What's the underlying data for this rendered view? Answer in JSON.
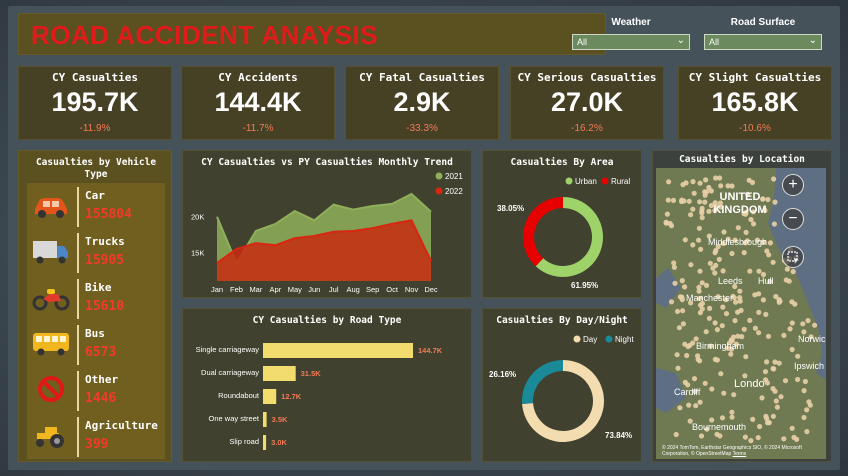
{
  "title": "ROAD ACCIDENT ANAYSIS",
  "filters": {
    "weather": {
      "label": "Weather",
      "value": "All"
    },
    "road_surface": {
      "label": "Road Surface",
      "value": "All"
    }
  },
  "kpis": [
    {
      "title": "CY Casualties",
      "value": "195.7K",
      "delta": "-11.9%"
    },
    {
      "title": "CY Accidents",
      "value": "144.4K",
      "delta": "-11.7%"
    },
    {
      "title": "CY Fatal Casualties",
      "value": "2.9K",
      "delta": "-33.3%"
    },
    {
      "title": "CY Serious Casualties",
      "value": "27.0K",
      "delta": "-16.2%"
    },
    {
      "title": "CY Slight Casualties",
      "value": "165.8K",
      "delta": "-10.6%"
    }
  ],
  "vehicles": {
    "title": "Casualties by Vehicle Type",
    "items": [
      {
        "name": "Car",
        "value": "155804",
        "icon": "car-icon"
      },
      {
        "name": "Trucks",
        "value": "15905",
        "icon": "truck-icon"
      },
      {
        "name": "Bike",
        "value": "15610",
        "icon": "motorbike-icon"
      },
      {
        "name": "Bus",
        "value": "6573",
        "icon": "bus-icon"
      },
      {
        "name": "Other",
        "value": "1446",
        "icon": "prohibited-icon"
      },
      {
        "name": "Agriculture",
        "value": "399",
        "icon": "tractor-icon"
      }
    ]
  },
  "colors": {
    "series_2021": "#8fb05a",
    "series_2022": "#d8260f",
    "bar": "#f2dc6e",
    "urban": "#9ed36a",
    "rural": "#e60000",
    "day": "#f3dcb0",
    "night": "#1a8a98",
    "delta": "#f27a54",
    "vehicle_value": "#f23b2a"
  },
  "chart_data": [
    {
      "type": "area",
      "title": "CY Casualties vs PY Casualties Monthly Trend",
      "categories": [
        "Jan",
        "Feb",
        "Mar",
        "Apr",
        "May",
        "Jun",
        "Jul",
        "Aug",
        "Sep",
        "Oct",
        "Nov",
        "Dec"
      ],
      "series": [
        {
          "name": "2021",
          "values": [
            20000,
            13500,
            18000,
            19000,
            20800,
            19500,
            21700,
            21000,
            21500,
            21800,
            23200,
            20700
          ]
        },
        {
          "name": "2022",
          "values": [
            13500,
            15500,
            16300,
            16000,
            17000,
            17300,
            17900,
            18000,
            18400,
            19000,
            19500,
            13800
          ]
        }
      ],
      "y_ticks": [
        "15K",
        "20K"
      ],
      "legend": "top-right"
    },
    {
      "type": "bar",
      "title": "CY Casualties by Road Type",
      "categories": [
        "Single carriageway",
        "Dual carriageway",
        "Roundabout",
        "One way street",
        "Slip road"
      ],
      "values": [
        144700,
        31500,
        12700,
        3500,
        3000
      ],
      "data_labels": [
        "144.7K",
        "31.5K",
        "12.7K",
        "3.5K",
        "3.0K"
      ]
    },
    {
      "type": "pie",
      "title": "Casualties By Area",
      "categories": [
        "Urban",
        "Rural"
      ],
      "values": [
        61.95,
        38.05
      ],
      "data_labels": [
        "61.95%",
        "38.05%"
      ],
      "legend": "top"
    },
    {
      "type": "pie",
      "title": "Casualties By Day/Night",
      "categories": [
        "Day",
        "Night"
      ],
      "values": [
        73.84,
        26.16
      ],
      "data_labels": [
        "73.84%",
        "26.16%"
      ],
      "legend": "top"
    }
  ],
  "map": {
    "title": "Casualties by Location",
    "labels": {
      "country": "UNITED KINGDOM",
      "middlesbrough": "Middlesbrough",
      "leeds": "Leeds",
      "hull": "Hull",
      "manchester": "Manchester",
      "birmingham": "Birmingham",
      "norwich": "Norwic",
      "ipswich": "Ipswich",
      "cardiff": "Cardiff",
      "london": "Londo",
      "bournemouth": "Bournemouth"
    },
    "attribution": "© 2024 TomTom, Earthstar Geographics SIO, © 2024 Microsoft Corporation, © OpenStreetMap",
    "terms": "Terms",
    "zoom_in": "+",
    "zoom_out": "−"
  }
}
